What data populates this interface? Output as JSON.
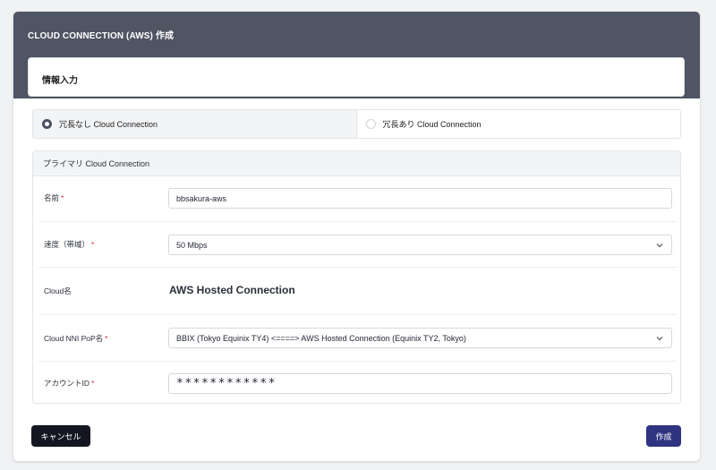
{
  "modal": {
    "title": "CLOUD CONNECTION (AWS) 作成",
    "section_title": "情報入力"
  },
  "redundancy": {
    "options": [
      {
        "label": "冗長なし Cloud Connection",
        "selected": true
      },
      {
        "label": "冗長あり Cloud Connection",
        "selected": false
      }
    ]
  },
  "panel": {
    "title": "プライマリ Cloud Connection",
    "fields": {
      "name": {
        "label": "名前",
        "required": "*",
        "value": "bbsakura-aws"
      },
      "speed": {
        "label": "速度（帯域）",
        "required": "*",
        "value": "50 Mbps"
      },
      "cloud_name": {
        "label": "Cloud名",
        "value": "AWS Hosted Connection"
      },
      "nni_pop": {
        "label": "Cloud NNI PoP名",
        "required": "*",
        "value": "BBIX (Tokyo Equinix TY4) <====> AWS Hosted Connection (Equinix TY2, Tokyo)"
      },
      "account_id": {
        "label": "アカウントID",
        "required": "*",
        "value": "************"
      }
    }
  },
  "buttons": {
    "cancel": "キャンセル",
    "create": "作成"
  }
}
